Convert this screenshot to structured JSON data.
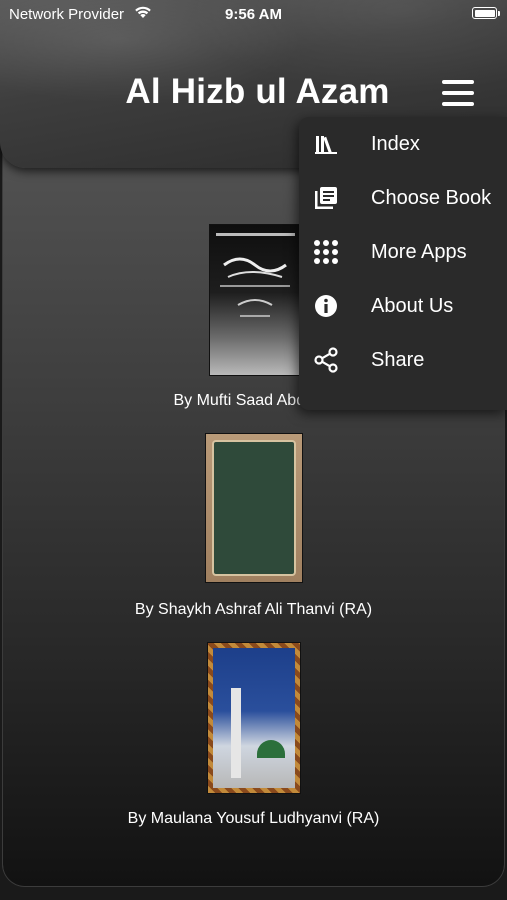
{
  "status_bar": {
    "carrier": "Network Provider",
    "time": "9:56 AM",
    "battery_level": 1.0
  },
  "header": {
    "title": "Al Hizb ul Azam"
  },
  "books": [
    {
      "author": "By Mufti Saad Abdul R"
    },
    {
      "author": "By Shaykh Ashraf Ali Thanvi (RA)"
    },
    {
      "author": "By Maulana Yousuf Ludhyanvi (RA)"
    }
  ],
  "menu": {
    "items": [
      {
        "label": "Index",
        "icon": "library-icon"
      },
      {
        "label": "Choose Book",
        "icon": "book-list-icon"
      },
      {
        "label": "More Apps",
        "icon": "apps-grid-icon"
      },
      {
        "label": "About Us",
        "icon": "info-icon"
      },
      {
        "label": "Share",
        "icon": "share-icon"
      }
    ]
  },
  "colors": {
    "menu_background": "#2a2a2a",
    "header_background": "#3e3e3e",
    "text": "#ffffff"
  }
}
